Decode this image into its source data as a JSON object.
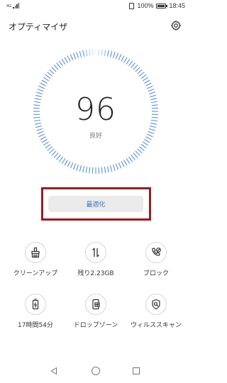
{
  "status_bar": {
    "network": "4G",
    "battery": "100%",
    "time": "18:45"
  },
  "header": {
    "title": "オプティマイザ",
    "settings_icon": "gear-icon"
  },
  "score": {
    "value": "96",
    "label": "良好",
    "dial_color": "#5b8fe0"
  },
  "optimize_button": {
    "label": "最適化",
    "color": "#3a76c4",
    "highlight_color": "#9c1b1f"
  },
  "tools": [
    {
      "label": "クリーンアップ",
      "icon": "broom-icon"
    },
    {
      "label": "残り2.23GB",
      "icon": "data-transfer-icon"
    },
    {
      "label": "ブロック",
      "icon": "phone-block-icon"
    },
    {
      "label": "17時間54分",
      "icon": "battery-icon"
    },
    {
      "label": "ドロップゾーン",
      "icon": "drop-zone-icon"
    },
    {
      "label": "ウィルススキャン",
      "icon": "virus-scan-icon"
    }
  ],
  "nav_bar": {
    "back": "back-icon",
    "home": "home-icon",
    "recents": "recents-icon"
  }
}
